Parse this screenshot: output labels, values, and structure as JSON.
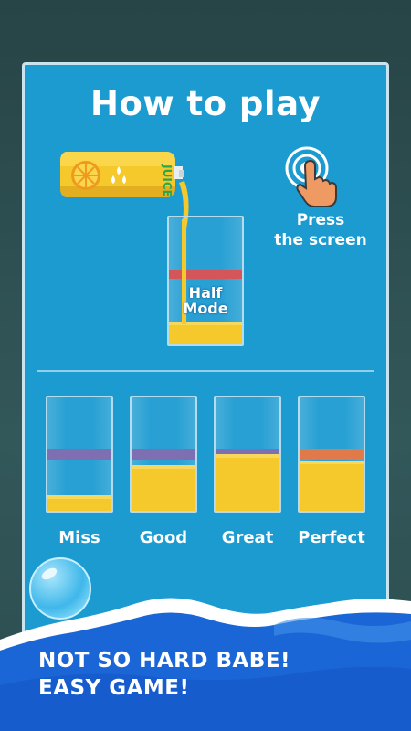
{
  "title": "How to play",
  "juice_pack_text": "JUICE",
  "instruction": {
    "line1": "Press",
    "line2": "the screen"
  },
  "demo_glass": {
    "line1": "Half",
    "line2": "Mode"
  },
  "results": [
    {
      "label": "Miss",
      "fill": 0.14
    },
    {
      "label": "Good",
      "fill": 0.4
    },
    {
      "label": "Great",
      "fill": 0.5
    },
    {
      "label": "Perfect",
      "fill": 0.44
    }
  ],
  "banner": {
    "line1": "NOT SO HARD BABE!",
    "line2": "EASY GAME!"
  },
  "colors": {
    "panel": "#1c9bd1",
    "juice": "#f5c82b",
    "wave": "#1b66d6",
    "target_line": "#d4565a"
  }
}
